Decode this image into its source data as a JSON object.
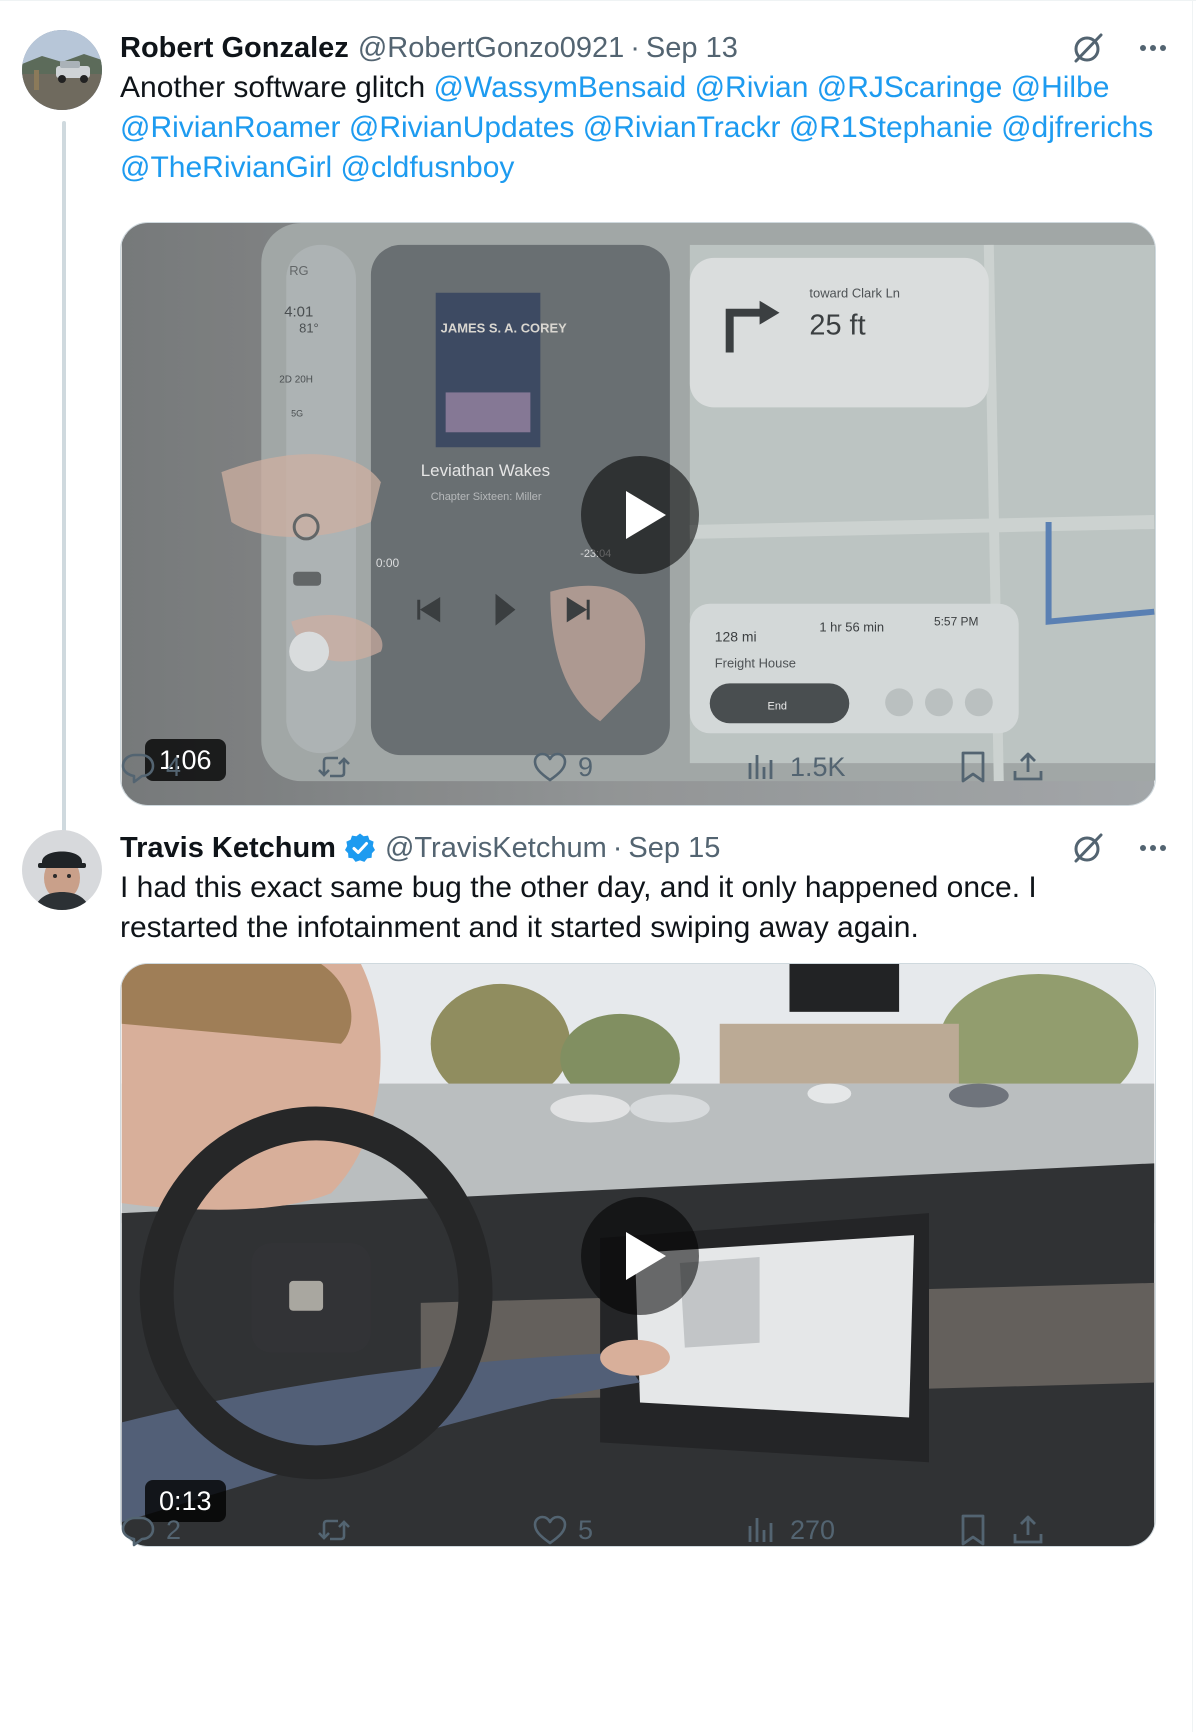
{
  "tweets": [
    {
      "author_name": "Robert Gonzalez",
      "handle": "@RobertGonzo0921",
      "separator": "·",
      "date": "Sep 13",
      "text_plain": "Another software glitch ",
      "mentions": [
        "@WassymBensaid",
        "@Rivian",
        "@RJScaringe",
        "@Hilbe",
        "@RivianRoamer",
        "@RivianUpdates",
        "@RivianTrackr",
        "@R1Stephanie",
        "@djfrerichs",
        "@TheRivianGirl",
        "@cldfusnboy"
      ],
      "media": {
        "duration": "1:06",
        "screen_text": {
          "rg": "RG",
          "time": "4:01",
          "temp": "81°",
          "charge": "2D 20H",
          "signal": "5G",
          "book_author": "JAMES S. A. COREY",
          "book_title": "Leviathan Wakes",
          "chapter": "Chapter Sixteen: Miller",
          "elapsed": "0:00",
          "remaining": "-23:04",
          "nav_direction": "toward Clark Ln",
          "nav_distance": "25 ft",
          "trip_distance": "128 mi",
          "trip_time": "1 hr 56 min",
          "arrival": "5:57 PM",
          "destination": "Freight House",
          "end_button": "End"
        }
      },
      "stats": {
        "replies": "4",
        "reposts": "",
        "likes": "9",
        "views": "1.5K"
      }
    },
    {
      "author_name": "Travis Ketchum",
      "verified": true,
      "handle": "@TravisKetchum",
      "separator": "·",
      "date": "Sep 15",
      "text": "I had this exact same bug the other day, and it only happened once. I restarted the infotainment and it started swiping away again.",
      "media": {
        "duration": "0:13"
      },
      "stats": {
        "replies": "2",
        "reposts": "",
        "likes": "5",
        "views": "270"
      }
    }
  ],
  "icons": [
    "grok-icon",
    "more-icon",
    "reply-icon",
    "repost-icon",
    "like-icon",
    "views-icon",
    "bookmark-icon",
    "share-icon",
    "play-icon",
    "verified-badge-icon"
  ],
  "colors": {
    "link": "#1d9bf0",
    "secondary_text": "#536471",
    "verified": "#1d9bf0",
    "thread_line": "#cfd9de"
  }
}
